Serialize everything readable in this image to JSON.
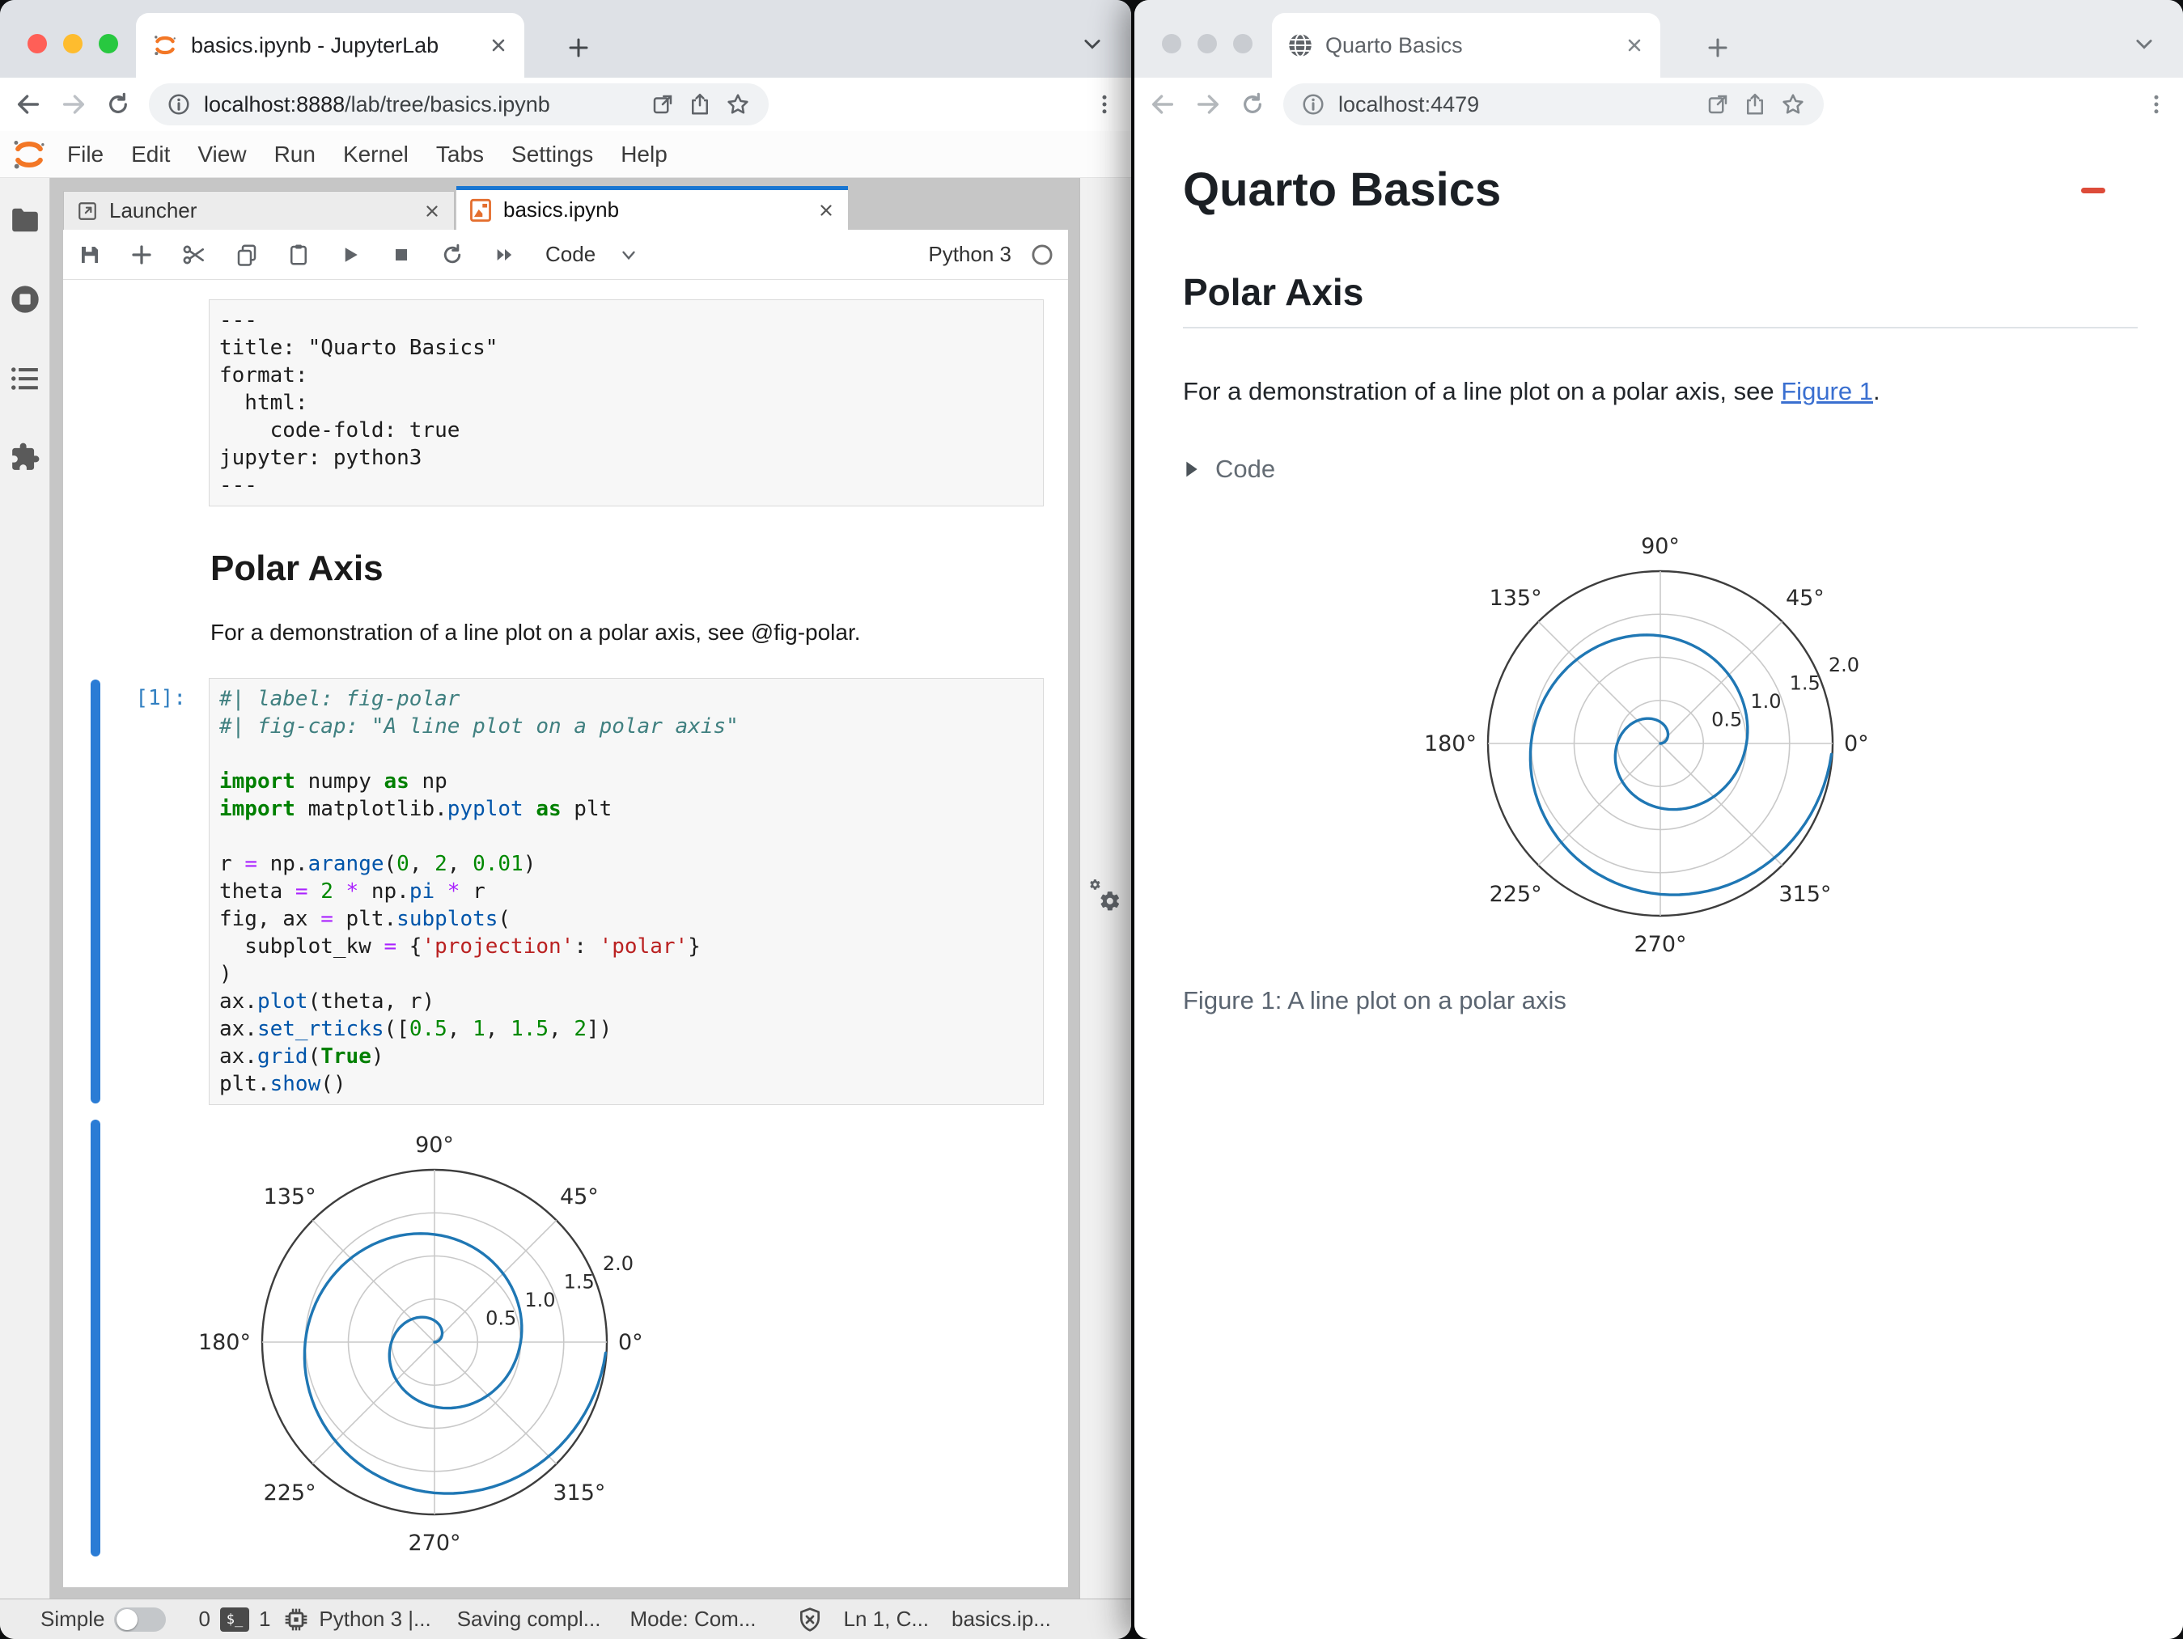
{
  "left_window": {
    "browser": {
      "tab_title": "basics.ipynb - JupyterLab",
      "url_host": "localhost:8888",
      "url_path": "/lab/tree/basics.ipynb"
    },
    "menu": [
      "File",
      "Edit",
      "View",
      "Run",
      "Kernel",
      "Tabs",
      "Settings",
      "Help"
    ],
    "doc_tabs": {
      "launcher": "Launcher",
      "notebook": "basics.ipynb"
    },
    "toolbar": {
      "cell_type": "Code",
      "kernel": "Python 3"
    },
    "notebook": {
      "raw_cell_lines": [
        "---",
        "title: \"Quarto Basics\"",
        "format:",
        "  html:",
        "    code-fold: true",
        "jupyter: python3",
        "---"
      ],
      "markdown": {
        "heading": "Polar Axis",
        "paragraph": "For a demonstration of a line plot on a polar axis, see @fig-polar."
      },
      "code_cell": {
        "prompt": "[1]:",
        "lines": [
          [
            {
              "c": "cm",
              "t": "#| label: fig-polar"
            }
          ],
          [
            {
              "c": "cm",
              "t": "#| fig-cap: \"A line plot on a polar axis\""
            }
          ],
          [],
          [
            {
              "c": "kw",
              "t": "import"
            },
            {
              "c": "pl",
              "t": " numpy "
            },
            {
              "c": "kw",
              "t": "as"
            },
            {
              "c": "pl",
              "t": " np"
            }
          ],
          [
            {
              "c": "kw",
              "t": "import"
            },
            {
              "c": "pl",
              "t": " matplotlib."
            },
            {
              "c": "prop",
              "t": "pyplot"
            },
            {
              "c": "pl",
              "t": " "
            },
            {
              "c": "kw",
              "t": "as"
            },
            {
              "c": "pl",
              "t": " plt"
            }
          ],
          [],
          [
            {
              "c": "pl",
              "t": "r "
            },
            {
              "c": "op",
              "t": "="
            },
            {
              "c": "pl",
              "t": " np."
            },
            {
              "c": "prop",
              "t": "arange"
            },
            {
              "c": "pl",
              "t": "("
            },
            {
              "c": "num",
              "t": "0"
            },
            {
              "c": "pl",
              "t": ", "
            },
            {
              "c": "num",
              "t": "2"
            },
            {
              "c": "pl",
              "t": ", "
            },
            {
              "c": "num",
              "t": "0.01"
            },
            {
              "c": "pl",
              "t": ")"
            }
          ],
          [
            {
              "c": "pl",
              "t": "theta "
            },
            {
              "c": "op",
              "t": "="
            },
            {
              "c": "pl",
              "t": " "
            },
            {
              "c": "num",
              "t": "2"
            },
            {
              "c": "pl",
              "t": " "
            },
            {
              "c": "op",
              "t": "*"
            },
            {
              "c": "pl",
              "t": " np."
            },
            {
              "c": "prop",
              "t": "pi"
            },
            {
              "c": "pl",
              "t": " "
            },
            {
              "c": "op",
              "t": "*"
            },
            {
              "c": "pl",
              "t": " r"
            }
          ],
          [
            {
              "c": "pl",
              "t": "fig, ax "
            },
            {
              "c": "op",
              "t": "="
            },
            {
              "c": "pl",
              "t": " plt."
            },
            {
              "c": "prop",
              "t": "subplots"
            },
            {
              "c": "pl",
              "t": "("
            }
          ],
          [
            {
              "c": "pl",
              "t": "  subplot_kw "
            },
            {
              "c": "op",
              "t": "="
            },
            {
              "c": "pl",
              "t": " {"
            },
            {
              "c": "str",
              "t": "'projection'"
            },
            {
              "c": "pl",
              "t": ": "
            },
            {
              "c": "str",
              "t": "'polar'"
            },
            {
              "c": "pl",
              "t": "}"
            }
          ],
          [
            {
              "c": "pl",
              "t": ")"
            }
          ],
          [
            {
              "c": "pl",
              "t": "ax."
            },
            {
              "c": "prop",
              "t": "plot"
            },
            {
              "c": "pl",
              "t": "(theta, r)"
            }
          ],
          [
            {
              "c": "pl",
              "t": "ax."
            },
            {
              "c": "prop",
              "t": "set_rticks"
            },
            {
              "c": "pl",
              "t": "(["
            },
            {
              "c": "num",
              "t": "0.5"
            },
            {
              "c": "pl",
              "t": ", "
            },
            {
              "c": "num",
              "t": "1"
            },
            {
              "c": "pl",
              "t": ", "
            },
            {
              "c": "num",
              "t": "1.5"
            },
            {
              "c": "pl",
              "t": ", "
            },
            {
              "c": "num",
              "t": "2"
            },
            {
              "c": "pl",
              "t": "])"
            }
          ],
          [
            {
              "c": "pl",
              "t": "ax."
            },
            {
              "c": "prop",
              "t": "grid"
            },
            {
              "c": "pl",
              "t": "("
            },
            {
              "c": "kw",
              "t": "True"
            },
            {
              "c": "pl",
              "t": ")"
            }
          ],
          [
            {
              "c": "pl",
              "t": "plt."
            },
            {
              "c": "prop",
              "t": "show"
            },
            {
              "c": "pl",
              "t": "()"
            }
          ]
        ]
      }
    },
    "statusbar": {
      "mode_toggle": "Simple",
      "terminals_count": "0",
      "kernels_count": "1",
      "kernel_status": "Python 3 |...",
      "saving": "Saving compl...",
      "mode": "Mode: Com...",
      "cursor": "Ln 1, C...",
      "file": "basics.ip..."
    }
  },
  "right_window": {
    "browser": {
      "tab_title": "Quarto Basics",
      "url_host": "localhost:4479"
    },
    "page": {
      "title": "Quarto Basics",
      "section": "Polar Axis",
      "para_before": "For a demonstration of a line plot on a polar axis, see ",
      "link_text": "Figure 1",
      "para_after": ".",
      "code_summary": "Code",
      "caption": "Figure 1: A line plot on a polar axis"
    }
  },
  "chart_data": {
    "type": "line",
    "projection": "polar",
    "description": "Archimedean spiral: r from 0 to 1.99 step 0.01, theta = 2*pi*r (two full turns)",
    "r_start": 0,
    "r_end": 1.99,
    "r_step": 0.01,
    "rlim": [
      0,
      2
    ],
    "r_ticks": [
      0.5,
      1.0,
      1.5,
      2.0
    ],
    "r_tick_labels": [
      "0.5",
      "1.0",
      "1.5",
      "2.0"
    ],
    "theta_ticks_deg": [
      0,
      45,
      90,
      135,
      180,
      225,
      270,
      315
    ],
    "theta_tick_labels": [
      "0°",
      "45°",
      "90°",
      "135°",
      "180°",
      "225°",
      "270°",
      "315°"
    ],
    "grid": true,
    "line_color": "#1f77b4"
  },
  "colors": {
    "brand_blue": "#1976d2",
    "prompt_blue": "#307fc1",
    "link_blue": "#3a6fd0",
    "spiral_blue": "#1f77b4",
    "jupyter_orange": "#f37726"
  }
}
